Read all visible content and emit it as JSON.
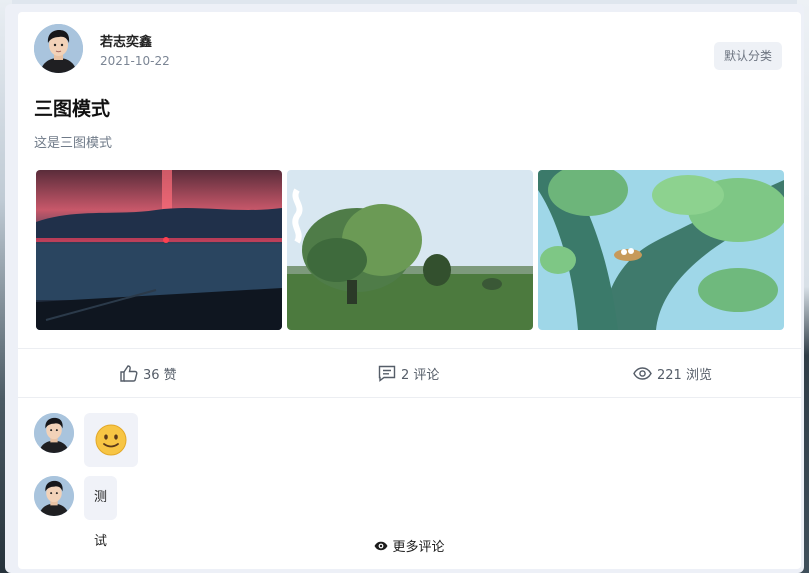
{
  "author": {
    "name": "若志奕鑫",
    "date": "2021-10-22"
  },
  "post": {
    "category": "默认分类",
    "title": "三图模式",
    "summary": "这是三图模式",
    "images": [
      "sunset-sea-painting",
      "tree-field-painting",
      "bird-nest-tree-painting"
    ]
  },
  "stats": {
    "likes": "36 赞",
    "comments": "2 评论",
    "views": "221 浏览"
  },
  "comments": [
    {
      "type": "emoji",
      "content": "slightly-smiling-face"
    },
    {
      "type": "text",
      "content": "测试"
    }
  ],
  "more_comments_label": "更多评论",
  "colors": {
    "card_bg": "#ffffff",
    "frame_bg": "#edf0f7",
    "tag_bg": "#eef1f6",
    "bubble_bg": "#f0f2f8",
    "muted_text": "#7b8594"
  }
}
